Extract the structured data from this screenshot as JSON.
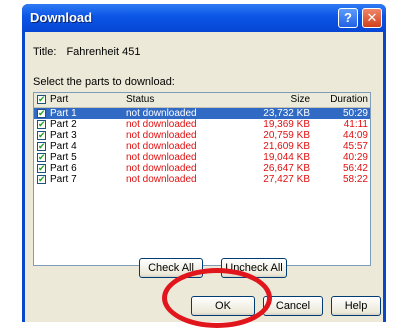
{
  "window": {
    "title": "Download",
    "help_glyph": "?",
    "close_glyph": "✕"
  },
  "info": {
    "title_label": "Title:",
    "title_value": "Fahrenheit 451",
    "select_label": "Select the parts to download:"
  },
  "list": {
    "header": {
      "part": "Part",
      "status": "Status",
      "size": "Size",
      "duration": "Duration"
    },
    "check_glyph": "✔",
    "rows": [
      {
        "part": "Part 1",
        "status": "not downloaded",
        "size": "23,732 KB",
        "duration": "50:29"
      },
      {
        "part": "Part 2",
        "status": "not downloaded",
        "size": "19,369 KB",
        "duration": "41:11"
      },
      {
        "part": "Part 3",
        "status": "not downloaded",
        "size": "20,759 KB",
        "duration": "44:09"
      },
      {
        "part": "Part 4",
        "status": "not downloaded",
        "size": "21,609 KB",
        "duration": "45:57"
      },
      {
        "part": "Part 5",
        "status": "not downloaded",
        "size": "19,044 KB",
        "duration": "40:29"
      },
      {
        "part": "Part 6",
        "status": "not downloaded",
        "size": "26,647 KB",
        "duration": "56:42"
      },
      {
        "part": "Part 7",
        "status": "not downloaded",
        "size": "27,427 KB",
        "duration": "58:22"
      }
    ]
  },
  "buttons": {
    "check_all": "Check All",
    "uncheck_all": "Uncheck All",
    "ok": "OK",
    "cancel": "Cancel",
    "help": "Help"
  },
  "colors": {
    "selection": "#316ac5",
    "status_text": "#e01010",
    "annotation": "#e1161d",
    "titlebar": "#0b55e6"
  }
}
